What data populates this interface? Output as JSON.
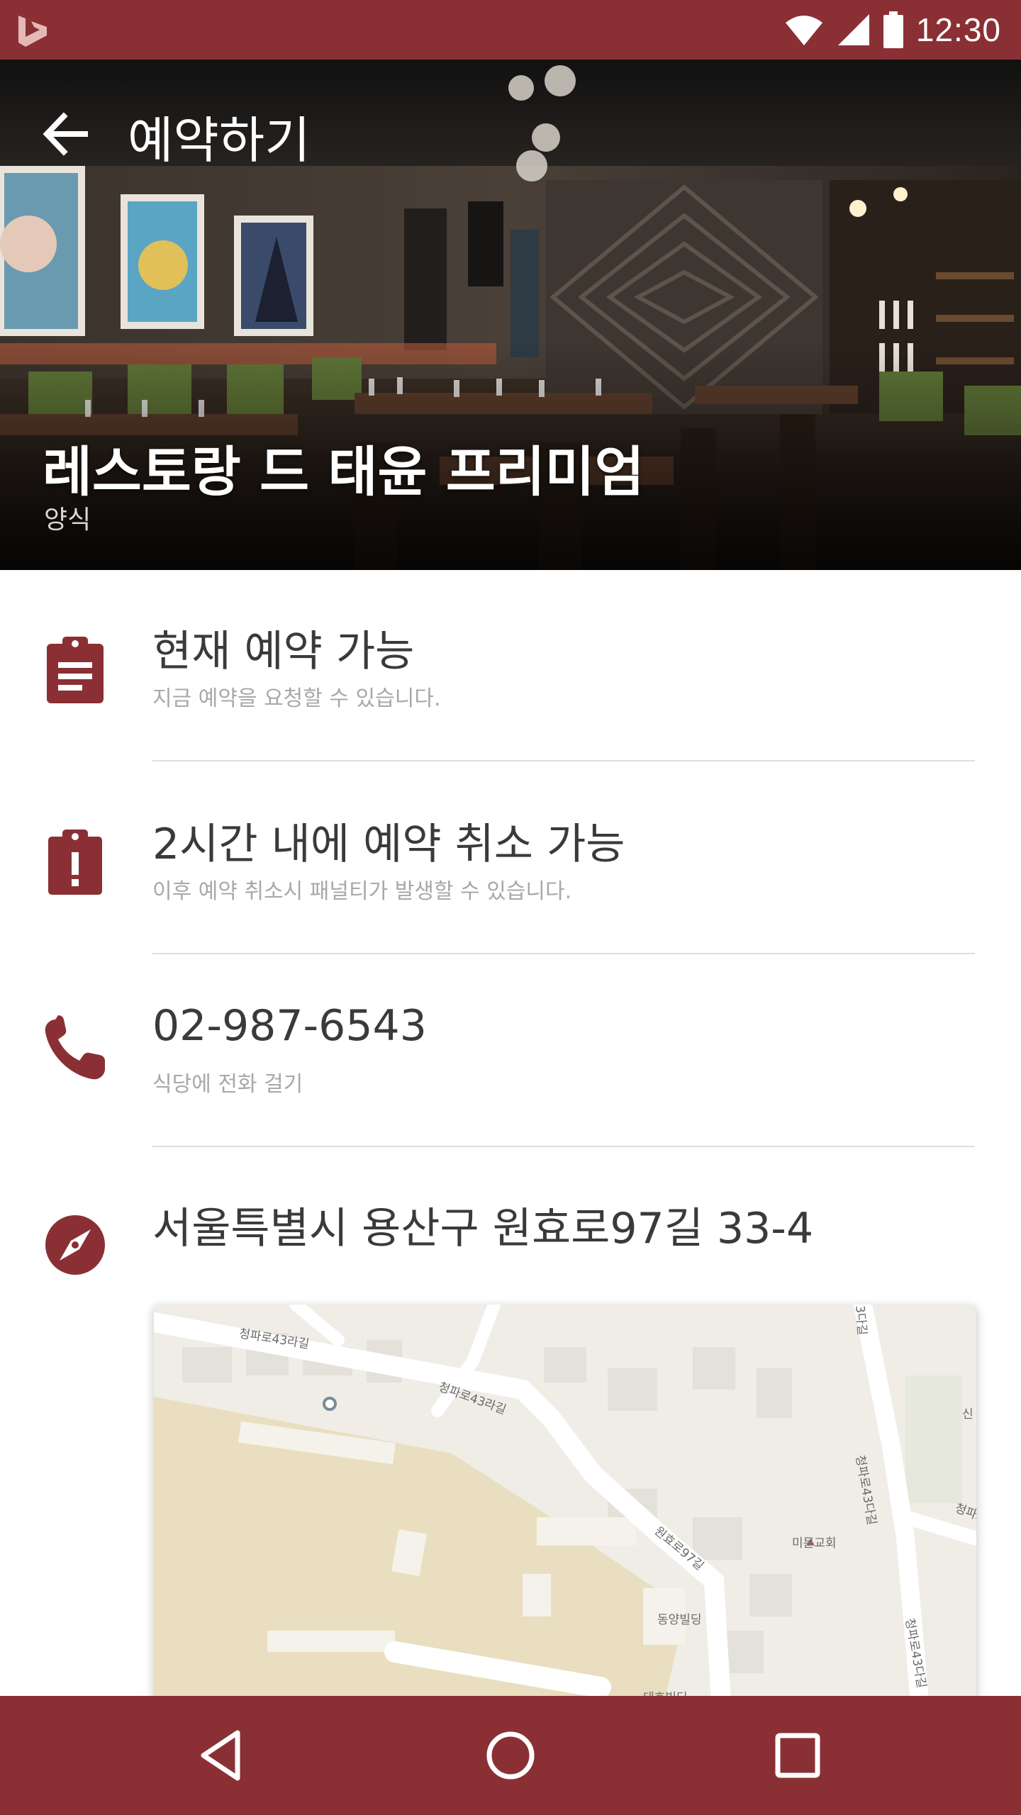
{
  "status_bar": {
    "time": "12:30"
  },
  "toolbar": {
    "title": "예약하기"
  },
  "restaurant": {
    "name": "레스토랑 드 태윤 프리미엄",
    "category": "양식"
  },
  "info": [
    {
      "title": "현재 예약 가능",
      "subtitle": "지금 예약을 요청할 수 있습니다.",
      "icon": "clipboard-list-icon"
    },
    {
      "title": "2시간 내에 예약 취소 가능",
      "subtitle": "이후 예약 취소시 패널티가 발생할 수 있습니다.",
      "icon": "clipboard-alert-icon"
    },
    {
      "title": "02-987-6543",
      "subtitle": "식당에 전화 걸기",
      "icon": "phone-icon"
    },
    {
      "title": "서울특별시 용산구 원효로97길 33-4",
      "icon": "compass-icon"
    }
  ],
  "map": {
    "labels": [
      "청파로43라길",
      "청파로43라길",
      "원효로97길",
      "미문교회",
      "동양빌딩",
      "청파로43다길",
      "청파로43다길",
      "청파로",
      "3다길",
      "신",
      "태호빌딩"
    ]
  },
  "colors": {
    "accent": "#8a3034",
    "text": "#3a3a3a",
    "subtext": "#a8a8a8"
  }
}
